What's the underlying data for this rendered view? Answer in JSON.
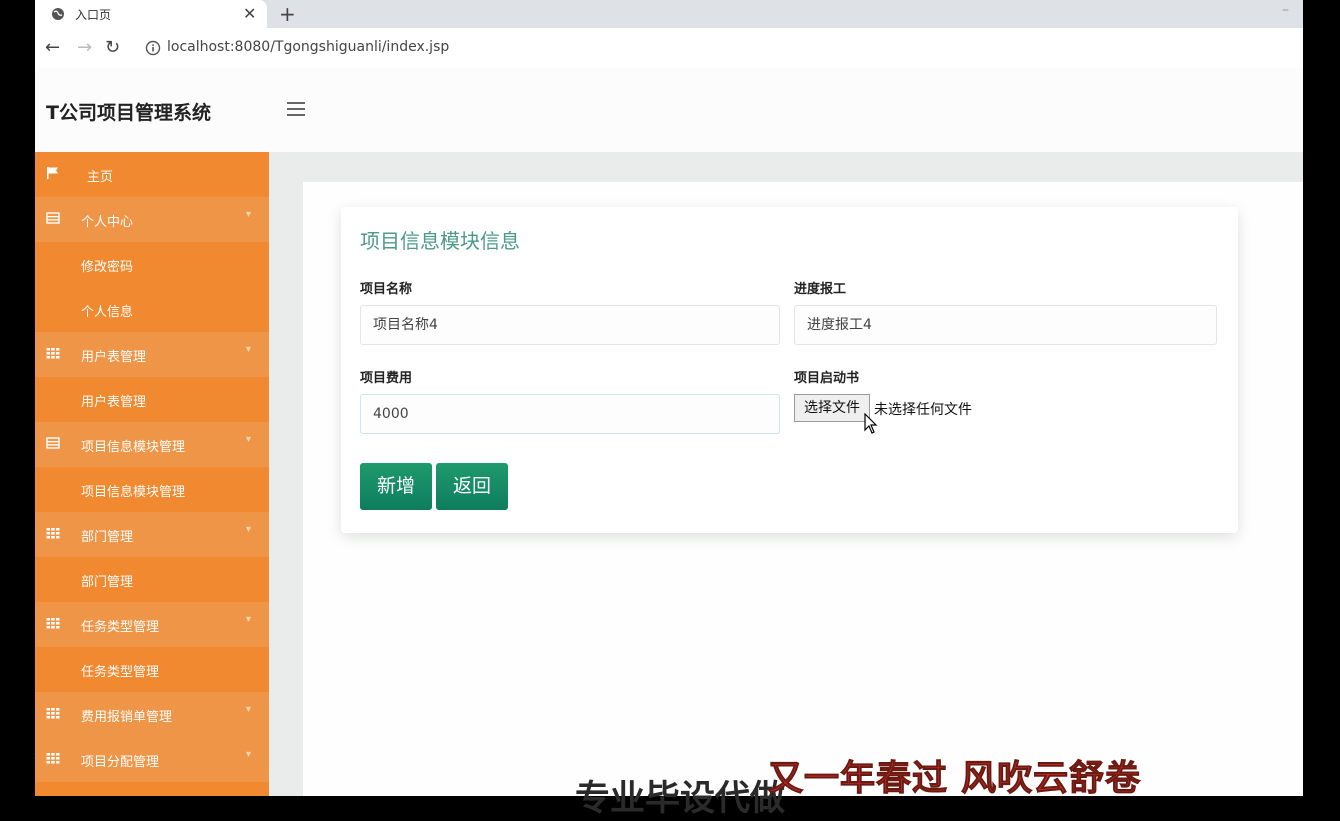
{
  "browser": {
    "tab_title": "入口页",
    "url": "localhost:8080/Tgongshiguanli/index.jsp"
  },
  "app": {
    "brand": "T公司项目管理系统"
  },
  "sidebar": {
    "items": [
      {
        "label": "主页",
        "icon": "flag-icon",
        "type": "top"
      },
      {
        "label": "个人中心",
        "icon": "table-icon",
        "type": "group"
      },
      {
        "label": "修改密码",
        "type": "sub"
      },
      {
        "label": "个人信息",
        "type": "sub"
      },
      {
        "label": "用户表管理",
        "icon": "grid-icon",
        "type": "group"
      },
      {
        "label": "用户表管理",
        "type": "sub"
      },
      {
        "label": "项目信息模块管理",
        "icon": "table-icon",
        "type": "group"
      },
      {
        "label": "项目信息模块管理",
        "type": "sub"
      },
      {
        "label": "部门管理",
        "icon": "grid-icon",
        "type": "group"
      },
      {
        "label": "部门管理",
        "type": "sub"
      },
      {
        "label": "任务类型管理",
        "icon": "grid-icon",
        "type": "group"
      },
      {
        "label": "任务类型管理",
        "type": "sub"
      },
      {
        "label": "费用报销单管理",
        "icon": "grid-icon",
        "type": "group"
      },
      {
        "label": "项目分配管理",
        "icon": "grid-icon",
        "type": "group"
      }
    ]
  },
  "form": {
    "title": "项目信息模块信息",
    "fields": {
      "name_label": "项目名称",
      "name_value": "项目名称4",
      "progress_label": "进度报工",
      "progress_value": "进度报工4",
      "cost_label": "项目费用",
      "cost_value": "4000",
      "file_label": "项目启动书",
      "file_button": "选择文件",
      "file_status": "未选择任何文件"
    },
    "buttons": {
      "add": "新增",
      "back": "返回"
    }
  },
  "overlay": {
    "subtitle": "又一年春过 风吹云舒卷",
    "subtitle_partial": "专业毕设代做"
  },
  "colors": {
    "sidebar": "#f0892f",
    "accent": "#4c9a8a",
    "button": "#12896a"
  }
}
